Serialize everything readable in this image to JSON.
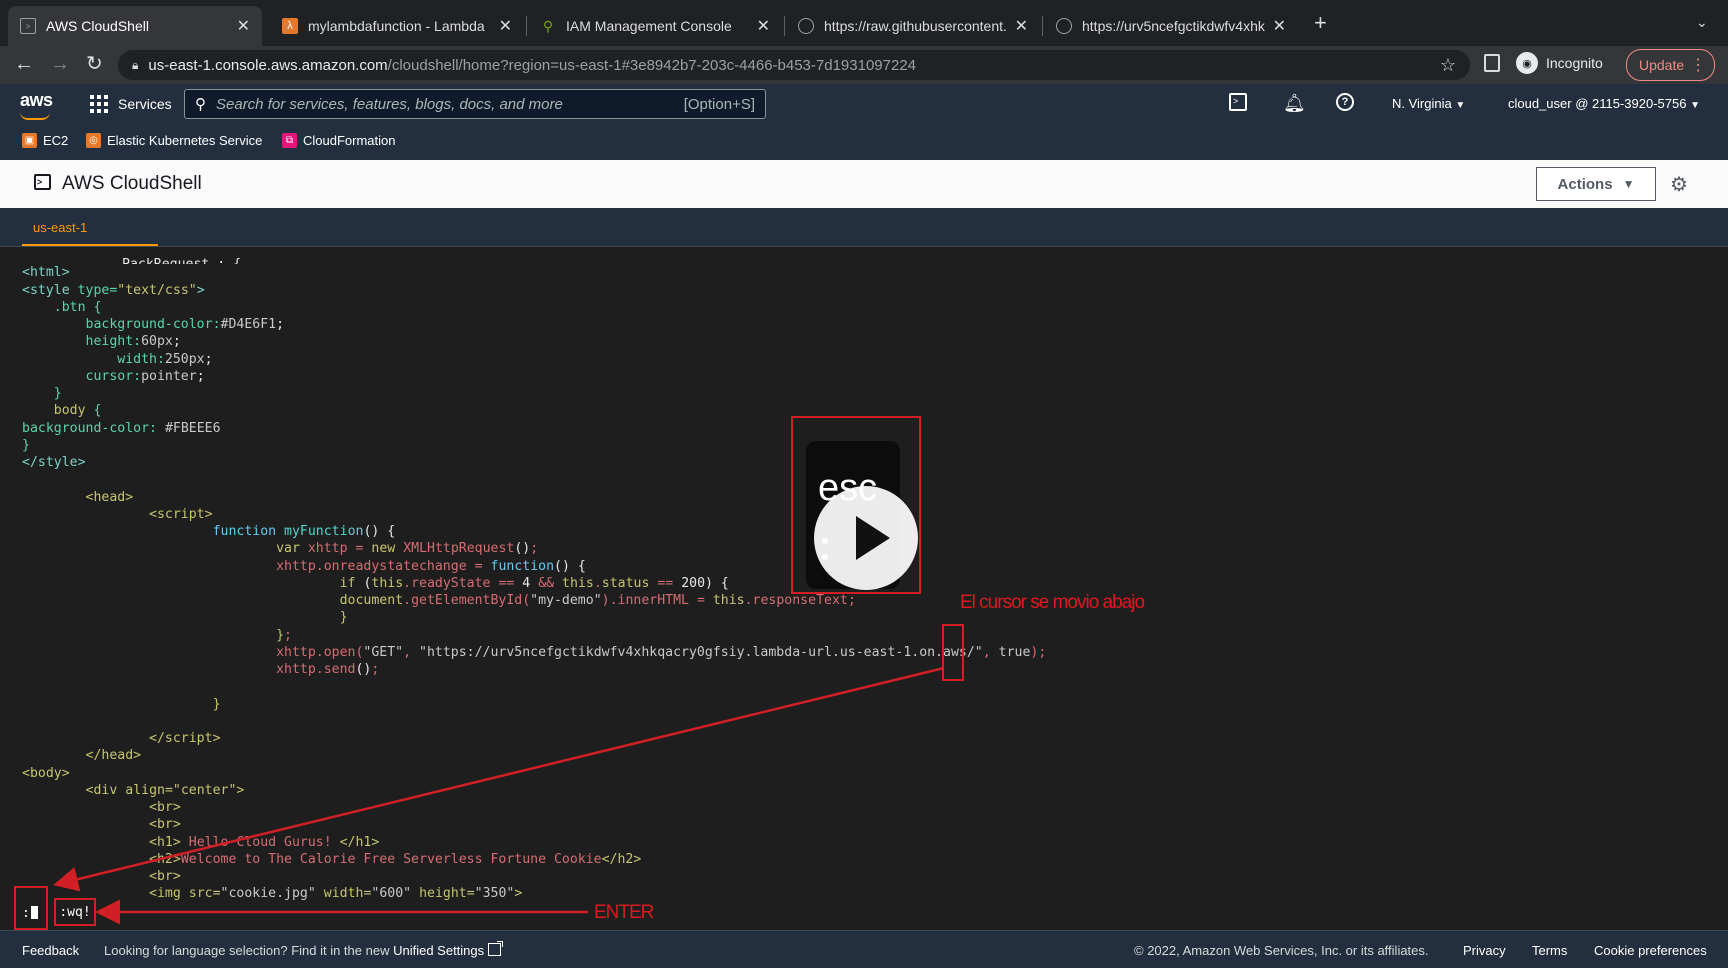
{
  "browser": {
    "tabs": [
      {
        "title": "AWS CloudShell",
        "icon": "cloudshell-icon"
      },
      {
        "title": "mylambdafunction - Lambda",
        "icon": "lambda-icon"
      },
      {
        "title": "IAM Management Console",
        "icon": "iam-icon"
      },
      {
        "title": "https://raw.githubusercontent.c",
        "icon": "globe-icon"
      },
      {
        "title": "https://urv5ncefgctikdwfv4xhk",
        "icon": "globe-icon"
      }
    ],
    "new_tab": "+",
    "url_host": "us-east-1.console.aws.amazon.com",
    "url_path": "/cloudshell/home?region=us-east-1#3e8942b7-203c-4466-b453-7d1931097224",
    "profile_label": "Incognito",
    "update_label": "Update",
    "accent_update": "#f28b82"
  },
  "aws_nav": {
    "logo": "aws",
    "services_label": "Services",
    "search_placeholder": "Search for services, features, blogs, docs, and more",
    "search_shortcut": "[Option+S]",
    "region": "N. Virginia",
    "account": "cloud_user @ 2115-3920-5756",
    "favorites": [
      {
        "label": "EC2",
        "color": "#e5782b"
      },
      {
        "label": "Elastic Kubernetes Service",
        "color": "#e5782b"
      },
      {
        "label": "CloudFormation",
        "color": "#e7157b"
      }
    ],
    "brand_orange": "#ff9900"
  },
  "cloudshell": {
    "title": "AWS CloudShell",
    "actions_label": "Actions",
    "region_tab": "us-east-1"
  },
  "editor": {
    "command_prefix": ":",
    "wq_command": ":wq!",
    "annotation_cursor": "El cursor se movio abajo",
    "annotation_enter": "ENTER",
    "esc_key_label": "esc",
    "annotation_color": "#e0181f"
  },
  "footer": {
    "feedback": "Feedback",
    "language_hint": "Looking for language selection? Find it in the new",
    "unified_settings": "Unified Settings",
    "copyright": "© 2022, Amazon Web Services, Inc. or its affiliates.",
    "privacy": "Privacy",
    "terms": "Terms",
    "cookies": "Cookie preferences"
  }
}
